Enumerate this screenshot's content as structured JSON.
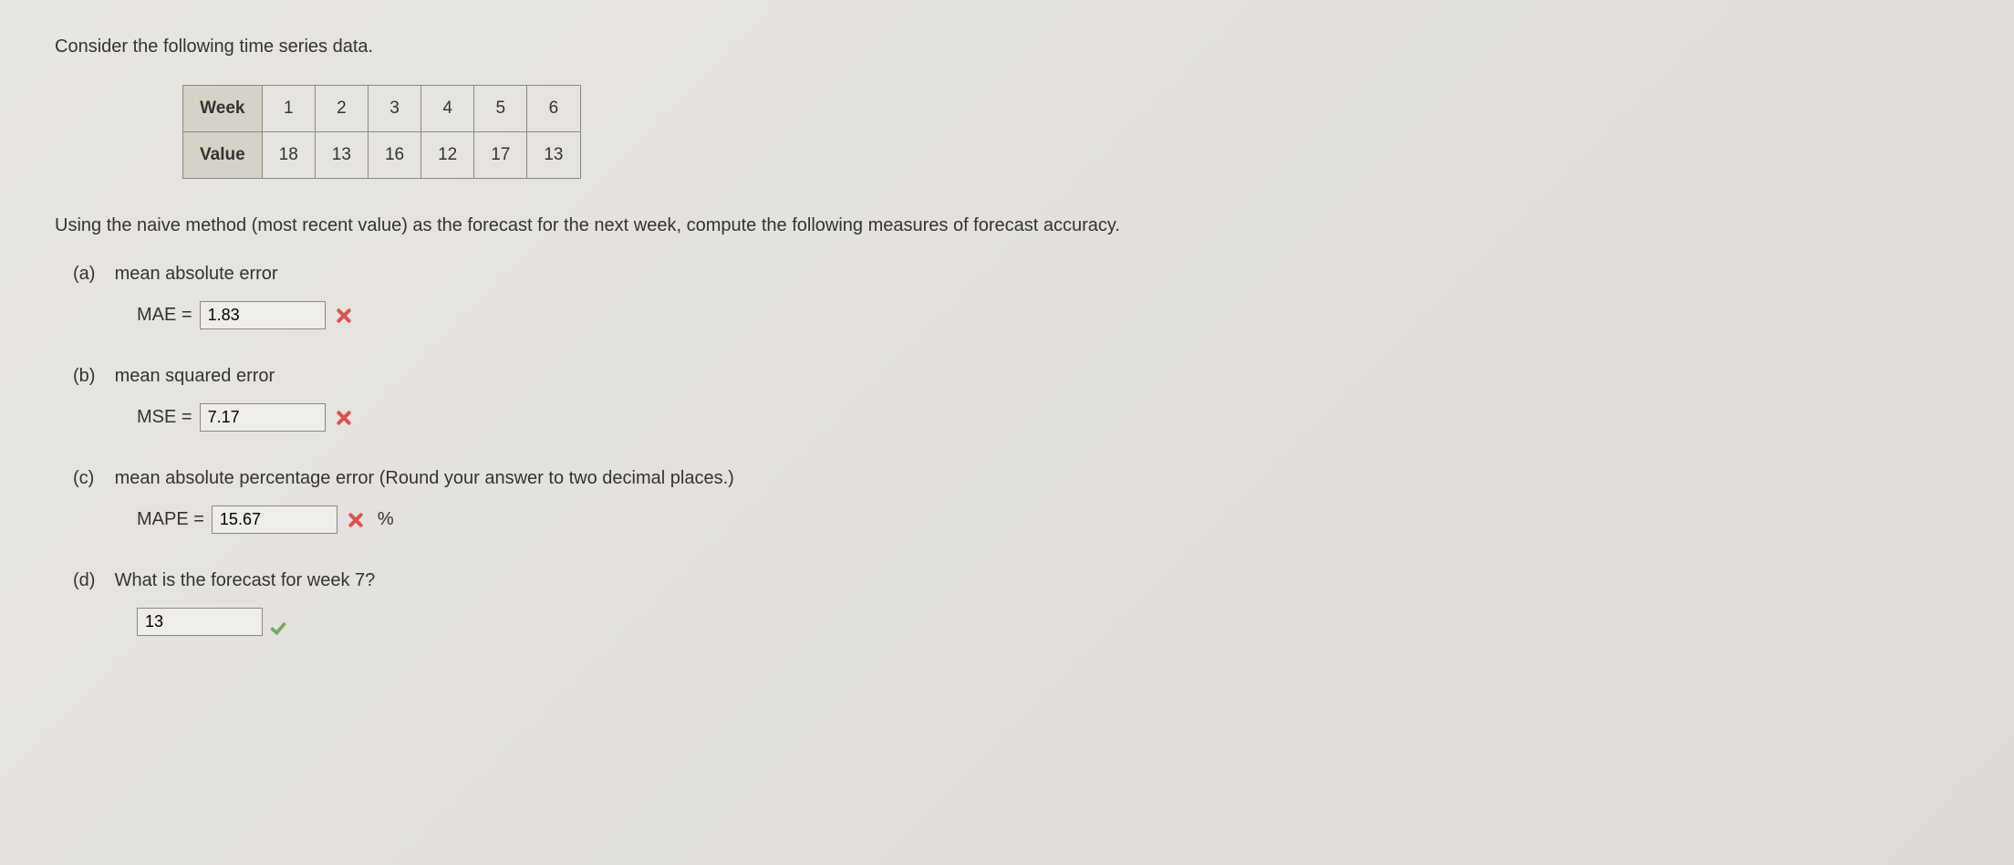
{
  "intro": "Consider the following time series data.",
  "table": {
    "row1_header": "Week",
    "row1": [
      "1",
      "2",
      "3",
      "4",
      "5",
      "6"
    ],
    "row2_header": "Value",
    "row2": [
      "18",
      "13",
      "16",
      "12",
      "17",
      "13"
    ]
  },
  "instruction": "Using the naive method (most recent value) as the forecast for the next week, compute the following measures of forecast accuracy.",
  "parts": {
    "a": {
      "label": "(a)",
      "title": "mean absolute error",
      "prefix": "MAE =",
      "value": "1.83",
      "status": "wrong"
    },
    "b": {
      "label": "(b)",
      "title": "mean squared error",
      "prefix": "MSE =",
      "value": "7.17",
      "status": "wrong"
    },
    "c": {
      "label": "(c)",
      "title": "mean absolute percentage error (Round your answer to two decimal places.)",
      "prefix": "MAPE =",
      "value": "15.67",
      "suffix": "%",
      "status": "wrong"
    },
    "d": {
      "label": "(d)",
      "title": "What is the forecast for week 7?",
      "prefix": "",
      "value": "13",
      "status": "correct"
    }
  }
}
